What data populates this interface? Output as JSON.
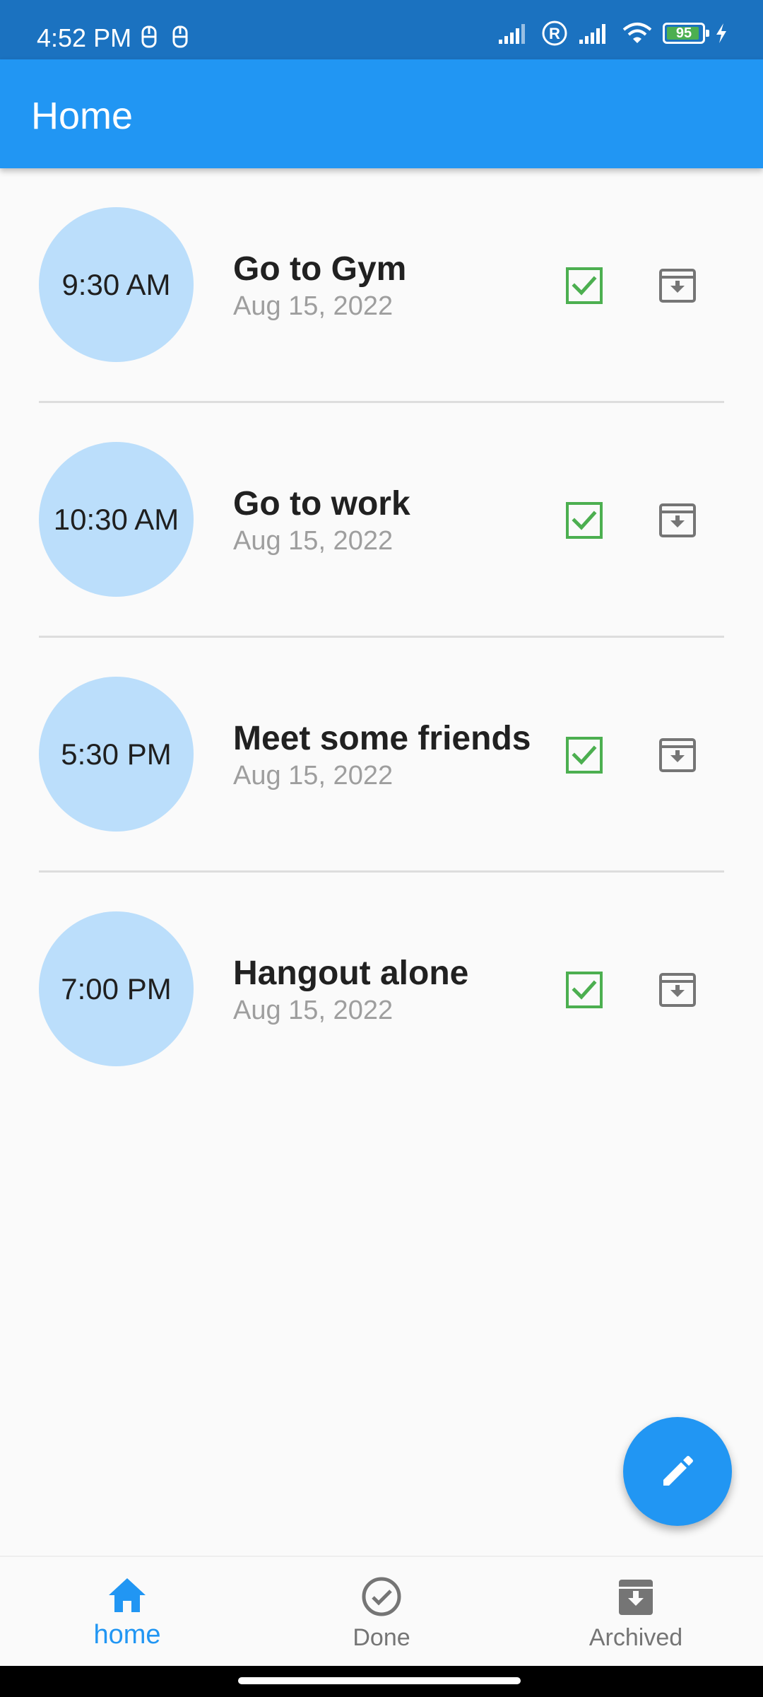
{
  "status_bar": {
    "time": "4:52 PM",
    "battery_level": "95",
    "battery_fraction": 0.95,
    "icons": [
      "notification-icon",
      "notification-icon",
      "signal-icon",
      "roaming-icon",
      "signal-icon",
      "wifi-icon",
      "battery-icon",
      "charging-icon"
    ]
  },
  "app_bar": {
    "title": "Home"
  },
  "tasks": [
    {
      "time": "9:30 AM",
      "title": "Go to Gym",
      "date": "Aug 15, 2022"
    },
    {
      "time": "10:30 AM",
      "title": "Go to work",
      "date": "Aug 15, 2022"
    },
    {
      "time": "5:30 PM",
      "title": "Meet some friends",
      "date": "Aug 15, 2022"
    },
    {
      "time": "7:00 PM",
      "title": "Hangout alone",
      "date": "Aug 15, 2022"
    }
  ],
  "actions": {
    "done_icon": "check-box-icon",
    "archive_icon": "archive-icon"
  },
  "fab": {
    "icon": "edit-icon"
  },
  "bottom_nav": {
    "items": [
      {
        "label": "home",
        "icon": "home-icon",
        "active": true
      },
      {
        "label": "Done",
        "icon": "check-circle-icon",
        "active": false
      },
      {
        "label": "Archived",
        "icon": "archive-icon",
        "active": false
      }
    ]
  },
  "colors": {
    "primary": "#2196F3",
    "status_bar": "#1B72C0",
    "circle": "#BBDEFB",
    "done_green": "#4CAF50",
    "archive_grey": "#757575",
    "date_grey": "#9E9E9E"
  }
}
